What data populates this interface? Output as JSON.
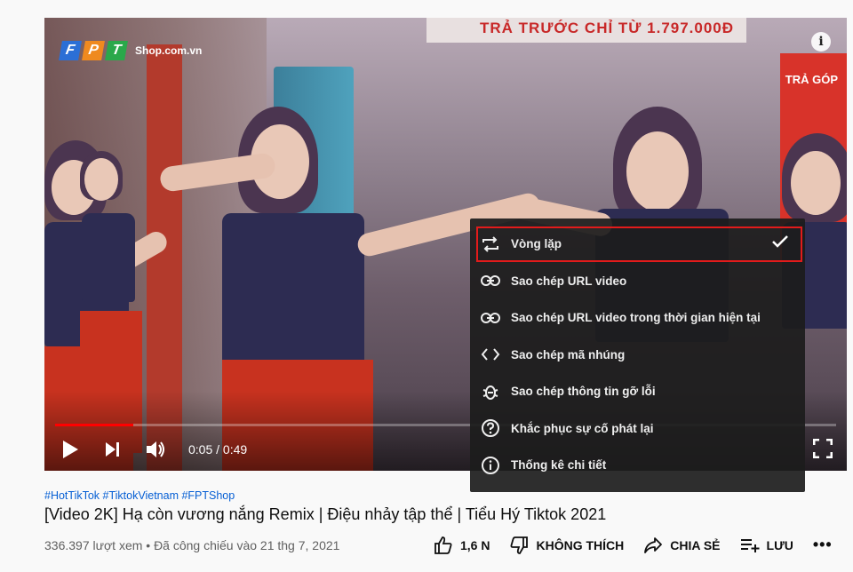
{
  "player": {
    "logo": {
      "letters": [
        "F",
        "P",
        "T"
      ],
      "colors": [
        "#2b6fd6",
        "#ef8a1f",
        "#2aa84a"
      ],
      "brand": "Shop.com.vn"
    },
    "info_icon": "i",
    "scene": {
      "sign_text": "TRẢ TRƯỚC CHỈ TỪ 1.797.000Đ",
      "banner_text": "TRẢ GÓP"
    },
    "time": "0:05 / 0:49",
    "progress": 0.1,
    "accent_color": "#ff0000"
  },
  "context_menu": {
    "items": [
      {
        "label": "Vòng lặp",
        "icon": "loop-icon",
        "checked": true,
        "highlighted": true
      },
      {
        "label": "Sao chép URL video",
        "icon": "link-icon"
      },
      {
        "label": "Sao chép URL video trong thời gian hiện tại",
        "icon": "link-icon"
      },
      {
        "label": "Sao chép mã nhúng",
        "icon": "code-icon"
      },
      {
        "label": "Sao chép thông tin gỡ lỗi",
        "icon": "bug-icon"
      },
      {
        "label": "Khắc phục sự cố phát lại",
        "icon": "help-icon"
      },
      {
        "label": "Thống kê chi tiết",
        "icon": "info-icon"
      }
    ],
    "highlight_color": "#e21b1b"
  },
  "video_info": {
    "hashtags": "#HotTikTok #TiktokVietnam #FPTShop",
    "title": "[Video 2K] Hạ còn vương nắng Remix | Điệu nhảy tập thể | Tiểu Hý Tiktok 2021",
    "meta": "336.397 lượt xem • Đã công chiếu vào 21 thg 7, 2021",
    "actions": {
      "like": "1,6 N",
      "dislike": "KHÔNG THÍCH",
      "share": "CHIA SẺ",
      "save": "LƯU",
      "more": "•••"
    }
  }
}
